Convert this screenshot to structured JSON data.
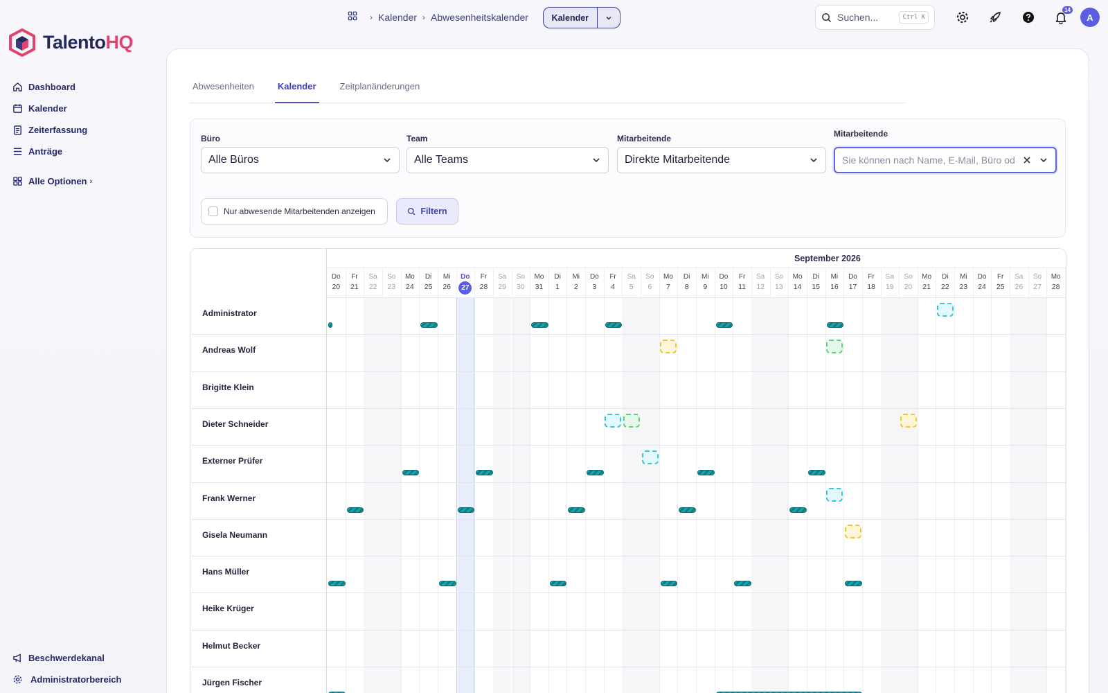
{
  "brand": {
    "name_a": "Talento",
    "name_b": "HQ"
  },
  "sidebar": {
    "items": [
      {
        "label": "Dashboard",
        "icon": "home-icon"
      },
      {
        "label": "Kalender",
        "icon": "calendar-icon"
      },
      {
        "label": "Zeiterfassung",
        "icon": "clipboard-icon"
      },
      {
        "label": "Anträge",
        "icon": "list-icon"
      }
    ],
    "all_options": "Alle Optionen",
    "bottom": [
      {
        "label": "Beschwerdekanal",
        "icon": "megaphone-icon"
      },
      {
        "label": "Administratorbereich",
        "icon": "gear-icon"
      }
    ]
  },
  "header": {
    "breadcrumb": [
      "Kalender",
      "Abwesenheitskalender"
    ],
    "split_button": "Kalender",
    "search_placeholder": "Suchen...",
    "search_shortcut": "Ctrl K",
    "notification_count": "14",
    "avatar_initial": "A"
  },
  "tabs": [
    {
      "label": "Abwesenheiten",
      "active": false
    },
    {
      "label": "Kalender",
      "active": true
    },
    {
      "label": "Zeitplanänderungen",
      "active": false
    }
  ],
  "filters": {
    "office": {
      "label": "Büro",
      "value": "Alle Büros"
    },
    "team": {
      "label": "Team",
      "value": "Alle Teams"
    },
    "employees": {
      "label": "Mitarbeitende",
      "value": "Direkte Mitarbeitende"
    },
    "employee_search": {
      "label": "Mitarbeitende",
      "placeholder": "Sie können nach Name, E-Mail, Büro oder"
    },
    "only_absent_label": "Nur abwesende Mitarbeitenden anzeigen",
    "filter_button": "Filtern"
  },
  "calendar": {
    "month": "September 2026",
    "today_index": 7,
    "days": [
      {
        "wd": "Do",
        "d": "20"
      },
      {
        "wd": "Fr",
        "d": "21"
      },
      {
        "wd": "Sa",
        "d": "22"
      },
      {
        "wd": "So",
        "d": "23"
      },
      {
        "wd": "Mo",
        "d": "24"
      },
      {
        "wd": "Di",
        "d": "25"
      },
      {
        "wd": "Mi",
        "d": "26"
      },
      {
        "wd": "Do",
        "d": "27"
      },
      {
        "wd": "Fr",
        "d": "28"
      },
      {
        "wd": "Sa",
        "d": "29"
      },
      {
        "wd": "So",
        "d": "30"
      },
      {
        "wd": "Mo",
        "d": "31"
      },
      {
        "wd": "Di",
        "d": "1"
      },
      {
        "wd": "Mi",
        "d": "2"
      },
      {
        "wd": "Do",
        "d": "3"
      },
      {
        "wd": "Fr",
        "d": "4"
      },
      {
        "wd": "Sa",
        "d": "5"
      },
      {
        "wd": "So",
        "d": "6"
      },
      {
        "wd": "Mo",
        "d": "7"
      },
      {
        "wd": "Di",
        "d": "8"
      },
      {
        "wd": "Mi",
        "d": "9"
      },
      {
        "wd": "Do",
        "d": "10"
      },
      {
        "wd": "Fr",
        "d": "11"
      },
      {
        "wd": "Sa",
        "d": "12"
      },
      {
        "wd": "So",
        "d": "13"
      },
      {
        "wd": "Mo",
        "d": "14"
      },
      {
        "wd": "Di",
        "d": "15"
      },
      {
        "wd": "Mi",
        "d": "16"
      },
      {
        "wd": "Do",
        "d": "17"
      },
      {
        "wd": "Fr",
        "d": "18"
      },
      {
        "wd": "Sa",
        "d": "19"
      },
      {
        "wd": "So",
        "d": "20"
      },
      {
        "wd": "Mo",
        "d": "21"
      },
      {
        "wd": "Di",
        "d": "22"
      },
      {
        "wd": "Mi",
        "d": "23"
      },
      {
        "wd": "Do",
        "d": "24"
      },
      {
        "wd": "Fr",
        "d": "25"
      },
      {
        "wd": "Sa",
        "d": "26"
      },
      {
        "wd": "So",
        "d": "27"
      },
      {
        "wd": "Mo",
        "d": "28"
      }
    ],
    "employees": [
      {
        "name": "Administrator",
        "bars": [
          [
            0,
            0.3
          ],
          [
            5,
            1
          ],
          [
            11,
            1
          ],
          [
            15,
            1
          ],
          [
            21,
            1
          ],
          [
            27,
            1
          ]
        ],
        "boxes": [
          [
            33,
            "cyan"
          ]
        ]
      },
      {
        "name": "Andreas Wolf",
        "bars": [],
        "boxes": [
          [
            18,
            "yellow"
          ],
          [
            27,
            "green"
          ]
        ]
      },
      {
        "name": "Brigitte Klein",
        "bars": [],
        "boxes": []
      },
      {
        "name": "Dieter Schneider",
        "bars": [],
        "boxes": [
          [
            15,
            "cyan"
          ],
          [
            16,
            "green"
          ],
          [
            31,
            "yellow"
          ]
        ]
      },
      {
        "name": "Externer Prüfer",
        "bars": [
          [
            4,
            1
          ],
          [
            8,
            1
          ],
          [
            14,
            1
          ],
          [
            20,
            1
          ],
          [
            26,
            1
          ]
        ],
        "boxes": [
          [
            17,
            "cyan"
          ]
        ]
      },
      {
        "name": "Frank Werner",
        "bars": [
          [
            1,
            1
          ],
          [
            7,
            1
          ],
          [
            13,
            1
          ],
          [
            19,
            1
          ],
          [
            25,
            1
          ]
        ],
        "boxes": [
          [
            27,
            "cyan"
          ]
        ]
      },
      {
        "name": "Gisela Neumann",
        "bars": [],
        "boxes": [
          [
            28,
            "yellow"
          ]
        ]
      },
      {
        "name": "Hans Müller",
        "bars": [
          [
            0,
            1
          ],
          [
            6,
            1
          ],
          [
            12,
            1
          ],
          [
            18,
            1
          ],
          [
            22,
            1
          ],
          [
            28,
            1
          ]
        ],
        "boxes": []
      },
      {
        "name": "Heike Krüger",
        "bars": [],
        "boxes": []
      },
      {
        "name": "Helmut Becker",
        "bars": [],
        "boxes": []
      },
      {
        "name": "Jürgen Fischer",
        "bars": [
          [
            0,
            1
          ],
          [
            21,
            8
          ]
        ],
        "boxes": []
      }
    ]
  }
}
